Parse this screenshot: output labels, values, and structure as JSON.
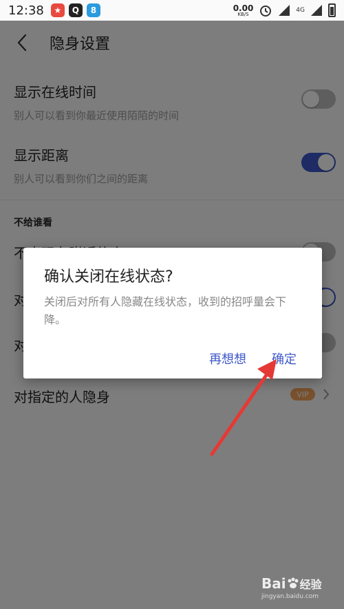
{
  "status_bar": {
    "time": "12:38",
    "app_icons": [
      {
        "icon": "app-icon-red",
        "color": "#e84a3f",
        "glyph": "★"
      },
      {
        "icon": "app-icon-dark",
        "color": "#222222",
        "glyph": "Q"
      },
      {
        "icon": "app-icon-blue",
        "color": "#2b9be0",
        "glyph": "8"
      }
    ],
    "net_speed": "0.00",
    "net_unit": "KB/S",
    "network_label": "4G"
  },
  "header": {
    "back_icon": "chevron-left-icon",
    "title": "隐身设置"
  },
  "settings": {
    "show_online_time": {
      "title": "显示在线时间",
      "subtitle": "别人可以看到你最近使用陌陌的时间",
      "enabled": false
    },
    "show_distance": {
      "title": "显示距离",
      "subtitle": "别人可以看到你们之间的距离",
      "enabled": true
    },
    "section_label": "不给谁看",
    "item_hidden_a": {
      "title": "不出现在附近的人",
      "enabled": false
    },
    "item_hidden_b": {
      "title": "对",
      "enabled": true
    },
    "item_hidden_c": {
      "title": "对",
      "enabled": false
    },
    "specific_people": {
      "title": "对指定的人隐身",
      "badge": "VIP"
    }
  },
  "dialog": {
    "title": "确认关闭在线状态?",
    "message": "关闭后对所有人隐藏在线状态，收到的招呼量会下降。",
    "cancel_label": "再想想",
    "confirm_label": "确定"
  },
  "colors": {
    "accent": "#3d57c9",
    "switch_off": "#bdbdbd",
    "vip": "#f0a35b",
    "annotation_arrow": "#e53935"
  },
  "watermark": {
    "logo": "Bai",
    "logo_suffix": "经验",
    "url": "jingyan.baidu.com"
  }
}
